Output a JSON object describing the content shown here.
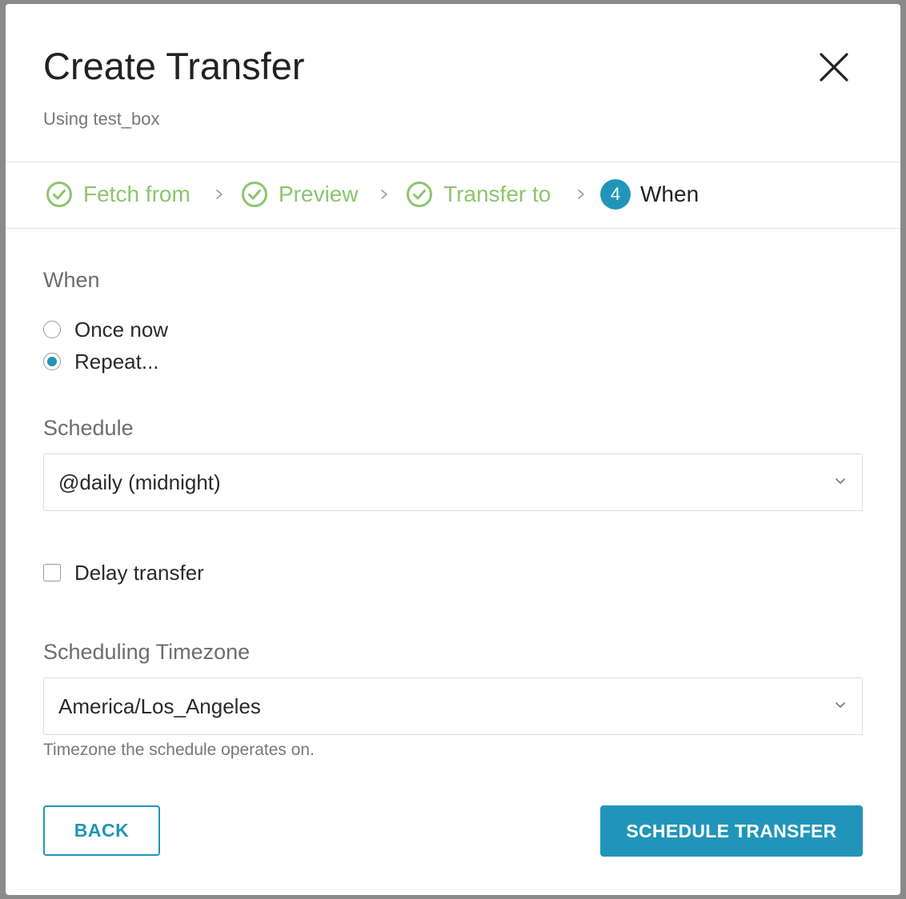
{
  "dialog": {
    "title": "Create Transfer",
    "subtitle": "Using test_box"
  },
  "stepper": {
    "steps": [
      {
        "label": "Fetch from",
        "state": "done"
      },
      {
        "label": "Preview",
        "state": "done"
      },
      {
        "label": "Transfer to",
        "state": "done"
      },
      {
        "label": "When",
        "state": "active",
        "number": "4"
      }
    ]
  },
  "when": {
    "label": "When",
    "options": [
      {
        "label": "Once now",
        "checked": false
      },
      {
        "label": "Repeat...",
        "checked": true
      }
    ]
  },
  "schedule": {
    "label": "Schedule",
    "value": "@daily (midnight)"
  },
  "delay": {
    "label": "Delay transfer",
    "checked": false
  },
  "timezone": {
    "label": "Scheduling Timezone",
    "value": "America/Los_Angeles",
    "help": "Timezone the schedule operates on."
  },
  "actions": {
    "back_label": "BACK",
    "submit_label": "SCHEDULE TRANSFER"
  },
  "colors": {
    "accent": "#2195b9",
    "step_done": "#8cc56d",
    "overlay": "#8a8a8a"
  }
}
